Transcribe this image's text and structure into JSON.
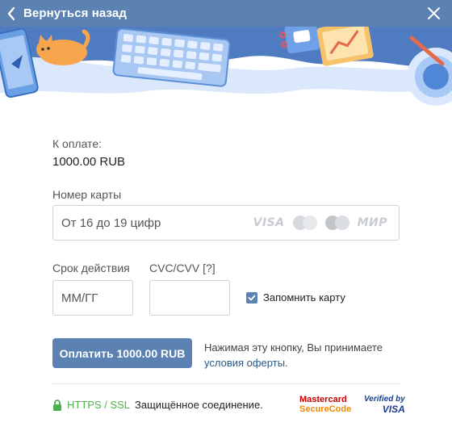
{
  "header": {
    "back_label": "Вернуться назад"
  },
  "payment": {
    "amount_label": "К оплате:",
    "amount_value": "1000.00 RUB"
  },
  "card": {
    "label": "Номер карты",
    "placeholder": "От 16 до 19 цифр",
    "brands": {
      "visa": "VISA",
      "mir": "МИР"
    }
  },
  "expiry": {
    "label": "Срок действия",
    "placeholder": "ММ/ГГ"
  },
  "cvc": {
    "label": "CVC/CVV [?]",
    "placeholder": ""
  },
  "remember": {
    "label": "Запомнить карту",
    "checked": true
  },
  "pay_button": {
    "label": "Оплатить 1000.00 RUB"
  },
  "terms": {
    "text": "Нажимая эту кнопку, Вы принимаете",
    "link": "условия оферты",
    "suffix": "."
  },
  "security": {
    "https": "HTTPS / SSL",
    "text": "Защищённое соединение."
  },
  "badges": {
    "mastercard_line1": "Mastercard",
    "mastercard_line2": "SecureCode",
    "visa_line1": "Verified by",
    "visa_line2": "VISA"
  },
  "colors": {
    "accent": "#5b82b3",
    "link": "#2a5885",
    "secure_green": "#4bb34b"
  }
}
